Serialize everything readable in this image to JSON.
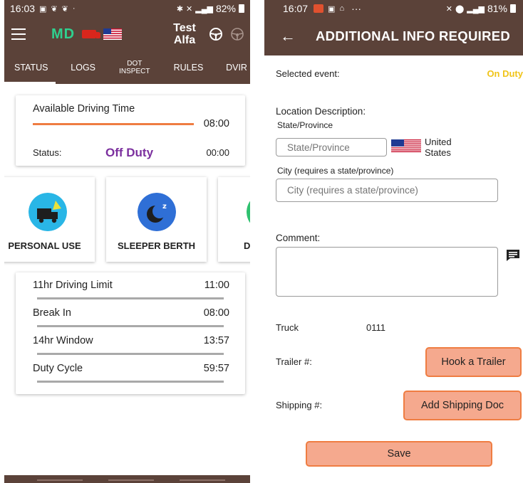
{
  "left": {
    "status_bar": {
      "time": "16:03",
      "battery": "82%"
    },
    "app_bar": {
      "md_label": "MD",
      "user_name": "Test Alfa"
    },
    "tabs": [
      {
        "label": "STATUS"
      },
      {
        "label": "LOGS"
      },
      {
        "label": "DOT INSPECT"
      },
      {
        "label": "RULES"
      },
      {
        "label": "DVIR"
      }
    ],
    "driving_time": {
      "title": "Available Driving Time",
      "remaining": "08:00",
      "status_label": "Status:",
      "status_value": "Off Duty",
      "status_time": "00:00"
    },
    "duty_cards": [
      {
        "label": "PERSONAL USE",
        "icon": "truck-icon",
        "color": "#29b6e6"
      },
      {
        "label": "SLEEPER BERTH",
        "icon": "moon-icon",
        "color": "#2f6fd6"
      },
      {
        "label": "D",
        "icon": "circle-icon",
        "color": "#2fc16f"
      }
    ],
    "limits": [
      {
        "name": "11hr Driving Limit",
        "value": "11:00"
      },
      {
        "name": "Break In",
        "value": "08:00"
      },
      {
        "name": "14hr Window",
        "value": "13:57"
      },
      {
        "name": "Duty Cycle",
        "value": "59:57"
      }
    ]
  },
  "right": {
    "status_bar": {
      "time": "16:07",
      "battery": "81%"
    },
    "title": "ADDITIONAL INFO REQUIRED",
    "selected_event_label": "Selected event:",
    "selected_event_value": "On Duty",
    "location_label": "Location Description:",
    "state_label": "State/Province",
    "state_placeholder": "State/Province",
    "country": "United States",
    "city_label": "City (requires a state/province)",
    "city_placeholder": "City (requires a state/province)",
    "comment_label": "Comment:",
    "truck_label": "Truck",
    "truck_value": "0111",
    "trailer_label": "Trailer #:",
    "hook_trailer_button": "Hook a Trailer",
    "shipping_label": "Shipping #:",
    "add_shipping_button": "Add Shipping Doc",
    "save_button": "Save"
  },
  "colors": {
    "header_brown": "#5b4239",
    "accent_orange": "#ef7d42",
    "button_fill": "#f5a98e",
    "off_duty_purple": "#7b2f9e",
    "on_duty_yellow": "#f0c419",
    "md_green": "#2fd08f"
  }
}
